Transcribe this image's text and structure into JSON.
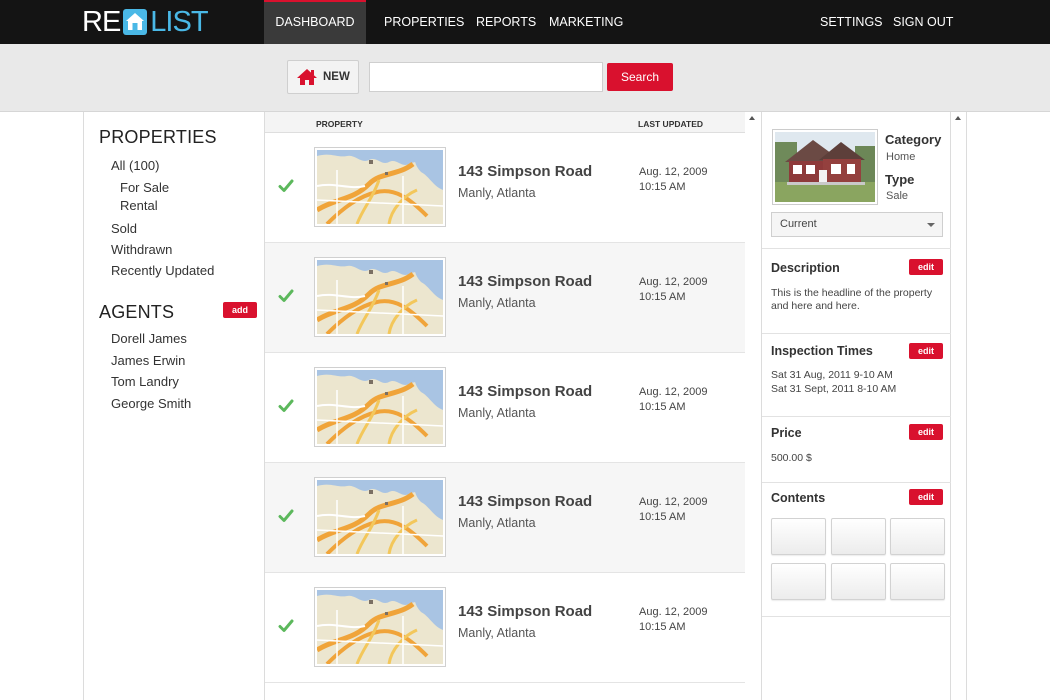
{
  "brand": {
    "part1": "RE",
    "part2": "LIST"
  },
  "nav": {
    "items": [
      "DASHBOARD",
      "PROPERTIES",
      "REPORTS",
      "MARKETING"
    ],
    "right": [
      "SETTINGS",
      "SIGN OUT"
    ],
    "active": "DASHBOARD"
  },
  "toolbar": {
    "new_label": "NEW",
    "search_value": "",
    "search_button": "Search"
  },
  "sidebar": {
    "properties_title": "PROPERTIES",
    "filters": [
      "All (100)",
      "For Sale",
      "Rental",
      "Sold",
      "Withdrawn",
      "Recently Updated"
    ],
    "agents_title": "AGENTS",
    "add_label": "add",
    "agents": [
      "Dorell James",
      "James Erwin",
      "Tom Landry",
      "George Smith"
    ]
  },
  "list": {
    "col_property": "PROPERTY",
    "col_updated": "LAST UPDATED",
    "rows": [
      {
        "address": "143 Simpson Road",
        "city": "Manly, Atlanta",
        "date": "Aug. 12, 2009",
        "time": "10:15 AM"
      },
      {
        "address": "143 Simpson Road",
        "city": "Manly, Atlanta",
        "date": "Aug. 12, 2009",
        "time": "10:15 AM"
      },
      {
        "address": "143 Simpson Road",
        "city": "Manly, Atlanta",
        "date": "Aug. 12, 2009",
        "time": "10:15 AM"
      },
      {
        "address": "143 Simpson Road",
        "city": "Manly, Atlanta",
        "date": "Aug. 12, 2009",
        "time": "10:15 AM"
      },
      {
        "address": "143 Simpson Road",
        "city": "Manly, Atlanta",
        "date": "Aug. 12, 2009",
        "time": "10:15 AM"
      }
    ]
  },
  "details": {
    "category_label": "Category",
    "category_value": "Home",
    "type_label": "Type",
    "type_value": "Sale",
    "status_select": "Current",
    "edit_label": "edit",
    "description_title": "Description",
    "description_text": "This is the headline of the property and here and here.",
    "inspection_title": "Inspection Times",
    "inspection_times": [
      "Sat 31 Aug, 2011 9-10 AM",
      "Sat 31 Sept, 2011 8-10 AM"
    ],
    "price_title": "Price",
    "price_value": "500.00 $",
    "contents_title": "Contents"
  },
  "colors": {
    "accent": "#d9112e",
    "brand_blue": "#4ab8e6",
    "topbar": "#141414",
    "toolbar": "#e9e9e9"
  },
  "icons": [
    "house-icon",
    "checkmark-icon",
    "chevron-down-icon",
    "scroll-up-arrow-icon"
  ]
}
